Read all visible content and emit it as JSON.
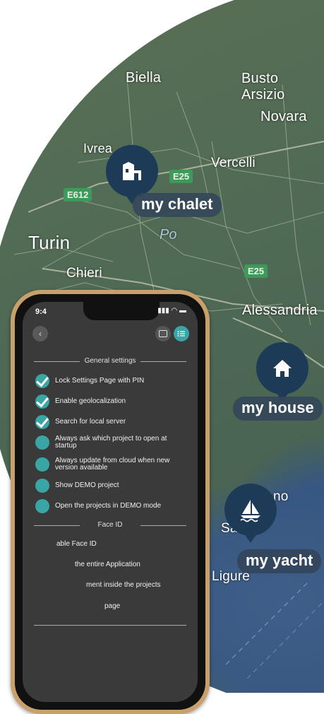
{
  "map": {
    "cities": {
      "biella": "Biella",
      "busto": "Busto Arsizio",
      "novara": "Novara",
      "ivrea": "Ivrea",
      "vercelli": "Vercelli",
      "turin": "Turin",
      "chieri": "Chieri",
      "alessandria": "Alessandria",
      "ligure": "Ligure",
      "savona_partial": "Sa",
      "genoa_partial": "no"
    },
    "river": "Po",
    "roads": [
      "E612",
      "E25",
      "E25"
    ],
    "pins": [
      {
        "label": "my chalet",
        "icon": "chalet-icon"
      },
      {
        "label": "my house",
        "icon": "house-icon"
      },
      {
        "label": "my yacht",
        "icon": "sailboat-icon"
      }
    ]
  },
  "phone": {
    "status_time": "9:4",
    "status_icons": "▮▮▮ ◠ ▬",
    "back_icon": "back-icon",
    "folder_icon": "folder-icon",
    "settings_icon": "list-settings-icon",
    "sections": {
      "general": "General settings",
      "faceid": "Face ID"
    },
    "general_settings": [
      {
        "label": "Lock Settings Page with PIN",
        "checked": true
      },
      {
        "label": "Enable geolocalization",
        "checked": true
      },
      {
        "label": "Search for local server",
        "checked": true
      },
      {
        "label": "Always ask which project to open at startup",
        "checked": false
      },
      {
        "label": "Always update from cloud when new version available",
        "checked": false
      },
      {
        "label": "Show DEMO project",
        "checked": false
      },
      {
        "label": "Open the projects in DEMO mode",
        "checked": false
      }
    ],
    "faceid_settings": [
      {
        "label": "able Face ID"
      },
      {
        "label": "the entire Application"
      },
      {
        "label": "ment inside the projects"
      },
      {
        "label": "page"
      }
    ]
  },
  "colors": {
    "accent": "#3aa5a5",
    "pin": "#1d3b57",
    "phone_frame": "#c9a06a"
  }
}
